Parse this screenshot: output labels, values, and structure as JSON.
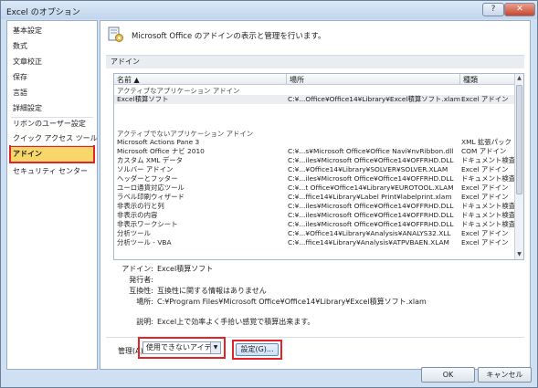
{
  "window": {
    "title": "Excel のオプション",
    "help": "?",
    "close": "✕"
  },
  "sidebar": {
    "items": [
      {
        "label": "基本設定"
      },
      {
        "label": "数式"
      },
      {
        "label": "文章校正"
      },
      {
        "label": "保存"
      },
      {
        "label": "言語"
      },
      {
        "label": "詳細設定"
      },
      {
        "label": "リボンのユーザー設定"
      },
      {
        "label": "クイック アクセス ツール バー"
      },
      {
        "label": "アドイン"
      },
      {
        "label": "セキュリティ センター"
      }
    ],
    "selected_index": 8
  },
  "header": {
    "text": "Microsoft Office のアドインの表示と管理を行います。"
  },
  "section": {
    "label": "アドイン"
  },
  "table": {
    "columns": {
      "name": "名前 ▲",
      "place": "場所",
      "type": "種類"
    },
    "active_group": "アクティブなアプリケーション アドイン",
    "active_rows": [
      {
        "name": "Excel積算ソフト",
        "place": "C:¥...Office¥Office14¥Library¥Excel積算ソフト.xlam",
        "type": "Excel アドイン"
      }
    ],
    "inactive_group": "アクティブでないアプリケーション アドイン",
    "inactive_rows": [
      {
        "name": "Microsoft Actions Pane 3",
        "place": "",
        "type": "XML 拡張パック"
      },
      {
        "name": "Microsoft Office ナビ 2010",
        "place": "C:¥...s¥Microsoft Office¥Office Navi¥nvRibbon.dll",
        "type": "COM アドイン"
      },
      {
        "name": "カスタム XML データ",
        "place": "C:¥...iles¥Microsoft Office¥Office14¥OFFRHD.DLL",
        "type": "ドキュメント検査"
      },
      {
        "name": "ソルバー アドイン",
        "place": "C:¥...¥Office14¥Library¥SOLVER¥SOLVER.XLAM",
        "type": "Excel アドイン"
      },
      {
        "name": "ヘッダーとフッター",
        "place": "C:¥...iles¥Microsoft Office¥Office14¥OFFRHD.DLL",
        "type": "ドキュメント検査"
      },
      {
        "name": "ユーロ通貨対応ツール",
        "place": "C:¥...t Office¥Office14¥Library¥EUROTOOL.XLAM",
        "type": "Excel アドイン"
      },
      {
        "name": "ラベル印刷ウィザード",
        "place": "C:¥...ffice14¥Library¥Label Print¥labelprint.xlam",
        "type": "Excel アドイン"
      },
      {
        "name": "非表示の行と列",
        "place": "C:¥...iles¥Microsoft Office¥Office14¥OFFRHD.DLL",
        "type": "ドキュメント検査"
      },
      {
        "name": "非表示の内容",
        "place": "C:¥...iles¥Microsoft Office¥Office14¥OFFRHD.DLL",
        "type": "ドキュメント検査"
      },
      {
        "name": "非表示ワークシート",
        "place": "C:¥...iles¥Microsoft Office¥Office14¥OFFRHD.DLL",
        "type": "ドキュメント検査"
      },
      {
        "name": "分析ツール",
        "place": "C:¥...¥Office14¥Library¥Analysis¥ANALYS32.XLL",
        "type": "Excel アドイン"
      },
      {
        "name": "分析ツール - VBA",
        "place": "C:¥...ffice14¥Library¥Analysis¥ATPVBAEN.XLAM",
        "type": "Excel アドイン"
      }
    ]
  },
  "details": {
    "addin_label": "アドイン:",
    "addin_value": "Excel積算ソフト",
    "publisher_label": "発行者:",
    "publisher_value": "",
    "compat_label": "互換性:",
    "compat_value": "互換性に関する情報はありません",
    "location_label": "場所:",
    "location_value": "C:¥Program Files¥Microsoft Office¥Office14¥Library¥Excel積算ソフト.xlam",
    "desc_label": "説明:",
    "desc_value": "Excel上で効率よく手拾い感覚で積算出来ます。"
  },
  "manage": {
    "label": "管理(A):",
    "selected": "使用できないアイテム",
    "go_label": "設定(G)..."
  },
  "footer": {
    "ok": "OK",
    "cancel": "キャンセル"
  },
  "colors": {
    "highlight_border": "#e3232a",
    "selected_fill": "#f8d76a"
  }
}
